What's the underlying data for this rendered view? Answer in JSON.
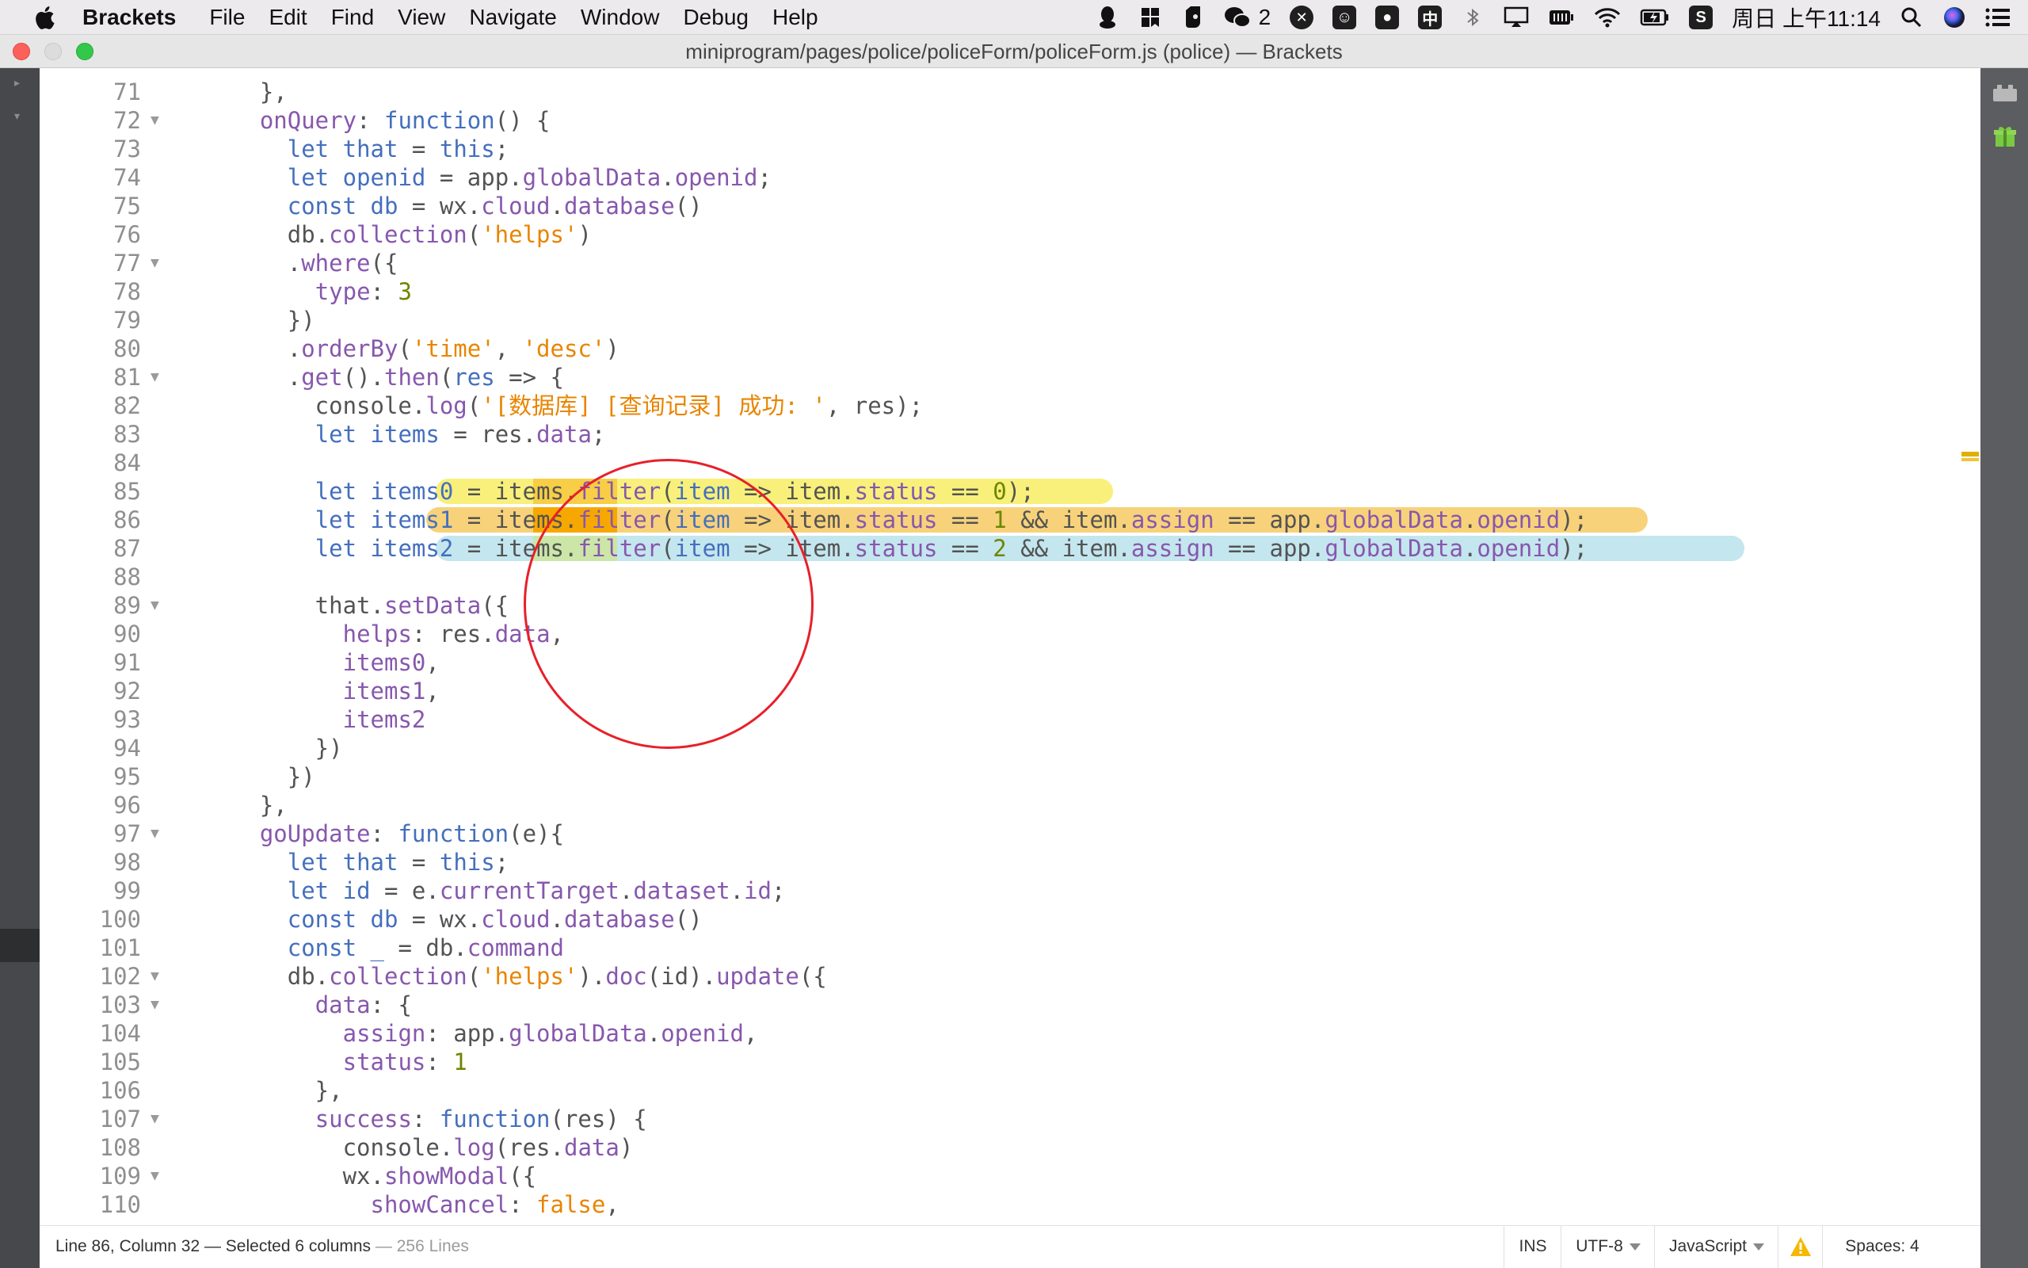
{
  "menubar": {
    "app_name": "Brackets",
    "menus": [
      "File",
      "Edit",
      "Find",
      "View",
      "Navigate",
      "Window",
      "Debug",
      "Help"
    ],
    "wechat_count": "2",
    "input_method": "中",
    "clock": "周日 上午11:14",
    "tray_icons": [
      "qq-icon",
      "bookmark-icon",
      "evernote-icon",
      "wechat-icon",
      "app-icon",
      "emoji-icon",
      "mic-icon",
      "input-method-icon",
      "bluetooth-icon",
      "airplay-icon",
      "battery-icon",
      "wifi-icon",
      "battery-charging-icon",
      "s-app-icon",
      "spotlight-icon",
      "siri-icon",
      "notification-center-icon"
    ]
  },
  "window": {
    "title": "miniprogram/pages/police/policeForm/policeForm.js (police) — Brackets"
  },
  "editor": {
    "lines": [
      {
        "n": "71",
        "fold": false,
        "tokens": [
          [
            "df",
            "    },"
          ]
        ]
      },
      {
        "n": "72",
        "fold": true,
        "tokens": [
          [
            "pr",
            "onQuery"
          ],
          [
            "df",
            ": "
          ],
          [
            "kw",
            "function"
          ],
          [
            "df",
            "() {"
          ]
        ],
        "indent": "    "
      },
      {
        "n": "73",
        "fold": false,
        "tokens": [
          [
            "df",
            "      "
          ],
          [
            "kw",
            "let"
          ],
          [
            "df",
            " "
          ],
          [
            "kw",
            "that"
          ],
          [
            "df",
            " = "
          ],
          [
            "kw",
            "this"
          ],
          [
            "df",
            ";"
          ]
        ]
      },
      {
        "n": "74",
        "fold": false,
        "tokens": [
          [
            "df",
            "      "
          ],
          [
            "kw",
            "let"
          ],
          [
            "df",
            " "
          ],
          [
            "kw",
            "openid"
          ],
          [
            "df",
            " = app."
          ],
          [
            "pr",
            "globalData"
          ],
          [
            "df",
            "."
          ],
          [
            "pr",
            "openid"
          ],
          [
            "df",
            ";"
          ]
        ]
      },
      {
        "n": "75",
        "fold": false,
        "tokens": [
          [
            "df",
            "      "
          ],
          [
            "kw",
            "const"
          ],
          [
            "df",
            " "
          ],
          [
            "kw",
            "db"
          ],
          [
            "df",
            " = wx."
          ],
          [
            "pr",
            "cloud"
          ],
          [
            "df",
            "."
          ],
          [
            "pr",
            "database"
          ],
          [
            "df",
            "()"
          ]
        ]
      },
      {
        "n": "76",
        "fold": false,
        "tokens": [
          [
            "df",
            "      db."
          ],
          [
            "pr",
            "collection"
          ],
          [
            "df",
            "("
          ],
          [
            "st",
            "'helps'"
          ],
          [
            "df",
            ")"
          ]
        ]
      },
      {
        "n": "77",
        "fold": true,
        "tokens": [
          [
            "df",
            "      ."
          ],
          [
            "pr",
            "where"
          ],
          [
            "df",
            "({"
          ]
        ]
      },
      {
        "n": "78",
        "fold": false,
        "tokens": [
          [
            "df",
            "        "
          ],
          [
            "pr",
            "type"
          ],
          [
            "df",
            ": "
          ],
          [
            "nm",
            "3"
          ]
        ]
      },
      {
        "n": "79",
        "fold": false,
        "tokens": [
          [
            "df",
            "      })"
          ]
        ]
      },
      {
        "n": "80",
        "fold": false,
        "tokens": [
          [
            "df",
            "      ."
          ],
          [
            "pr",
            "orderBy"
          ],
          [
            "df",
            "("
          ],
          [
            "st",
            "'time'"
          ],
          [
            "df",
            ", "
          ],
          [
            "st",
            "'desc'"
          ],
          [
            "df",
            ")"
          ]
        ]
      },
      {
        "n": "81",
        "fold": true,
        "tokens": [
          [
            "df",
            "      ."
          ],
          [
            "pr",
            "get"
          ],
          [
            "df",
            "()."
          ],
          [
            "pr",
            "then"
          ],
          [
            "df",
            "("
          ],
          [
            "kw",
            "res"
          ],
          [
            "df",
            " => {"
          ]
        ]
      },
      {
        "n": "82",
        "fold": false,
        "tokens": [
          [
            "df",
            "        console."
          ],
          [
            "pr",
            "log"
          ],
          [
            "df",
            "("
          ],
          [
            "st",
            "'[数据库] [查询记录] 成功: '"
          ],
          [
            "df",
            ", res);"
          ]
        ]
      },
      {
        "n": "83",
        "fold": false,
        "tokens": [
          [
            "df",
            "        "
          ],
          [
            "kw",
            "let"
          ],
          [
            "df",
            " "
          ],
          [
            "kw",
            "items"
          ],
          [
            "df",
            " = res."
          ],
          [
            "pr",
            "data"
          ],
          [
            "df",
            ";"
          ]
        ]
      },
      {
        "n": "84",
        "fold": false,
        "tokens": [
          [
            "df",
            ""
          ]
        ]
      },
      {
        "n": "85",
        "fold": false,
        "tokens": [
          [
            "df",
            "        "
          ],
          [
            "kw",
            "let"
          ],
          [
            "df",
            " "
          ],
          [
            "kw",
            "items0"
          ],
          [
            "df",
            " = items."
          ],
          [
            "pr",
            "filter"
          ],
          [
            "df",
            "("
          ],
          [
            "kw",
            "item"
          ],
          [
            "df",
            " => item."
          ],
          [
            "pr",
            "status"
          ],
          [
            "df",
            " == "
          ],
          [
            "nm",
            "0"
          ],
          [
            "df",
            ");"
          ]
        ]
      },
      {
        "n": "86",
        "fold": false,
        "tokens": [
          [
            "df",
            "        "
          ],
          [
            "kw",
            "let"
          ],
          [
            "df",
            " "
          ],
          [
            "kw",
            "items1"
          ],
          [
            "df",
            " = items."
          ],
          [
            "pr",
            "filter"
          ],
          [
            "df",
            "("
          ],
          [
            "kw",
            "item"
          ],
          [
            "df",
            " => item."
          ],
          [
            "pr",
            "status"
          ],
          [
            "df",
            " == "
          ],
          [
            "nm",
            "1"
          ],
          [
            "df",
            " && item."
          ],
          [
            "pr",
            "assign"
          ],
          [
            "df",
            " == app."
          ],
          [
            "pr",
            "globalData"
          ],
          [
            "df",
            "."
          ],
          [
            "pr",
            "openid"
          ],
          [
            "df",
            ");"
          ]
        ]
      },
      {
        "n": "87",
        "fold": false,
        "tokens": [
          [
            "df",
            "        "
          ],
          [
            "kw",
            "let"
          ],
          [
            "df",
            " "
          ],
          [
            "kw",
            "items2"
          ],
          [
            "df",
            " = items."
          ],
          [
            "pr",
            "filter"
          ],
          [
            "df",
            "("
          ],
          [
            "kw",
            "item"
          ],
          [
            "df",
            " => item."
          ],
          [
            "pr",
            "status"
          ],
          [
            "df",
            " == "
          ],
          [
            "nm",
            "2"
          ],
          [
            "df",
            " && item."
          ],
          [
            "pr",
            "assign"
          ],
          [
            "df",
            " == app."
          ],
          [
            "pr",
            "globalData"
          ],
          [
            "df",
            "."
          ],
          [
            "pr",
            "openid"
          ],
          [
            "df",
            ");"
          ]
        ]
      },
      {
        "n": "88",
        "fold": false,
        "tokens": [
          [
            "df",
            ""
          ]
        ]
      },
      {
        "n": "89",
        "fold": true,
        "tokens": [
          [
            "df",
            "        that."
          ],
          [
            "pr",
            "setData"
          ],
          [
            "df",
            "({"
          ]
        ]
      },
      {
        "n": "90",
        "fold": false,
        "tokens": [
          [
            "df",
            "          "
          ],
          [
            "pr",
            "helps"
          ],
          [
            "df",
            ": res."
          ],
          [
            "pr",
            "data"
          ],
          [
            "df",
            ","
          ]
        ]
      },
      {
        "n": "91",
        "fold": false,
        "tokens": [
          [
            "df",
            "          "
          ],
          [
            "pr",
            "items0"
          ],
          [
            "df",
            ","
          ]
        ]
      },
      {
        "n": "92",
        "fold": false,
        "tokens": [
          [
            "df",
            "          "
          ],
          [
            "pr",
            "items1"
          ],
          [
            "df",
            ","
          ]
        ]
      },
      {
        "n": "93",
        "fold": false,
        "tokens": [
          [
            "df",
            "          "
          ],
          [
            "pr",
            "items2"
          ]
        ]
      },
      {
        "n": "94",
        "fold": false,
        "tokens": [
          [
            "df",
            "        })"
          ]
        ]
      },
      {
        "n": "95",
        "fold": false,
        "tokens": [
          [
            "df",
            "      })"
          ]
        ]
      },
      {
        "n": "96",
        "fold": false,
        "tokens": [
          [
            "df",
            "    },"
          ]
        ]
      },
      {
        "n": "97",
        "fold": true,
        "tokens": [
          [
            "df",
            "    "
          ],
          [
            "pr",
            "goUpdate"
          ],
          [
            "df",
            ": "
          ],
          [
            "kw",
            "function"
          ],
          [
            "df",
            "(e){"
          ]
        ]
      },
      {
        "n": "98",
        "fold": false,
        "tokens": [
          [
            "df",
            "      "
          ],
          [
            "kw",
            "let"
          ],
          [
            "df",
            " "
          ],
          [
            "kw",
            "that"
          ],
          [
            "df",
            " = "
          ],
          [
            "kw",
            "this"
          ],
          [
            "df",
            ";"
          ]
        ]
      },
      {
        "n": "99",
        "fold": false,
        "tokens": [
          [
            "df",
            "      "
          ],
          [
            "kw",
            "let"
          ],
          [
            "df",
            " "
          ],
          [
            "kw",
            "id"
          ],
          [
            "df",
            " = e."
          ],
          [
            "pr",
            "currentTarget"
          ],
          [
            "df",
            "."
          ],
          [
            "pr",
            "dataset"
          ],
          [
            "df",
            "."
          ],
          [
            "pr",
            "id"
          ],
          [
            "df",
            ";"
          ]
        ]
      },
      {
        "n": "100",
        "fold": false,
        "tokens": [
          [
            "df",
            "      "
          ],
          [
            "kw",
            "const"
          ],
          [
            "df",
            " "
          ],
          [
            "kw",
            "db"
          ],
          [
            "df",
            " = wx."
          ],
          [
            "pr",
            "cloud"
          ],
          [
            "df",
            "."
          ],
          [
            "pr",
            "database"
          ],
          [
            "df",
            "()"
          ]
        ]
      },
      {
        "n": "101",
        "fold": false,
        "tokens": [
          [
            "df",
            "      "
          ],
          [
            "kw",
            "const"
          ],
          [
            "df",
            " "
          ],
          [
            "kw",
            "_"
          ],
          [
            "df",
            " = db."
          ],
          [
            "pr",
            "command"
          ]
        ]
      },
      {
        "n": "102",
        "fold": true,
        "tokens": [
          [
            "df",
            "      db."
          ],
          [
            "pr",
            "collection"
          ],
          [
            "df",
            "("
          ],
          [
            "st",
            "'helps'"
          ],
          [
            "df",
            ")."
          ],
          [
            "pr",
            "doc"
          ],
          [
            "df",
            "(id)."
          ],
          [
            "pr",
            "update"
          ],
          [
            "df",
            "({"
          ]
        ]
      },
      {
        "n": "103",
        "fold": true,
        "tokens": [
          [
            "df",
            "        "
          ],
          [
            "pr",
            "data"
          ],
          [
            "df",
            ": {"
          ]
        ]
      },
      {
        "n": "104",
        "fold": false,
        "tokens": [
          [
            "df",
            "          "
          ],
          [
            "pr",
            "assign"
          ],
          [
            "df",
            ": app."
          ],
          [
            "pr",
            "globalData"
          ],
          [
            "df",
            "."
          ],
          [
            "pr",
            "openid"
          ],
          [
            "df",
            ","
          ]
        ]
      },
      {
        "n": "105",
        "fold": false,
        "tokens": [
          [
            "df",
            "          "
          ],
          [
            "pr",
            "status"
          ],
          [
            "df",
            ": "
          ],
          [
            "nm",
            "1"
          ]
        ]
      },
      {
        "n": "106",
        "fold": false,
        "tokens": [
          [
            "df",
            "        },"
          ]
        ]
      },
      {
        "n": "107",
        "fold": true,
        "tokens": [
          [
            "df",
            "        "
          ],
          [
            "pr",
            "success"
          ],
          [
            "df",
            ": "
          ],
          [
            "kw",
            "function"
          ],
          [
            "df",
            "(res) {"
          ]
        ]
      },
      {
        "n": "108",
        "fold": false,
        "tokens": [
          [
            "df",
            "          console."
          ],
          [
            "pr",
            "log"
          ],
          [
            "df",
            "(res."
          ],
          [
            "pr",
            "data"
          ],
          [
            "df",
            ")"
          ]
        ]
      },
      {
        "n": "109",
        "fold": true,
        "tokens": [
          [
            "df",
            "          wx."
          ],
          [
            "pr",
            "showModal"
          ],
          [
            "df",
            "({"
          ]
        ]
      },
      {
        "n": "110",
        "fold": false,
        "tokens": [
          [
            "df",
            "            "
          ],
          [
            "pr",
            "showCancel"
          ],
          [
            "df",
            ": "
          ],
          [
            "st",
            "false"
          ],
          [
            "df",
            ","
          ]
        ]
      }
    ]
  },
  "colors": {
    "keyword": "#446fbd",
    "property": "#8757ad",
    "string": "#e88501",
    "number": "#6d8600",
    "highlight_yellow": "#f8f07a",
    "highlight_orange": "#f7d27a",
    "highlight_blue": "#c4e6ee",
    "annotation_circle": "#e8202a"
  },
  "statusbar": {
    "cursor": "Line 86, Column 32 — Selected 6 columns",
    "line_count": "— 256 Lines",
    "mode": "INS",
    "encoding": "UTF-8",
    "language": "JavaScript",
    "spaces_label": "Spaces:",
    "spaces_value": "4"
  }
}
